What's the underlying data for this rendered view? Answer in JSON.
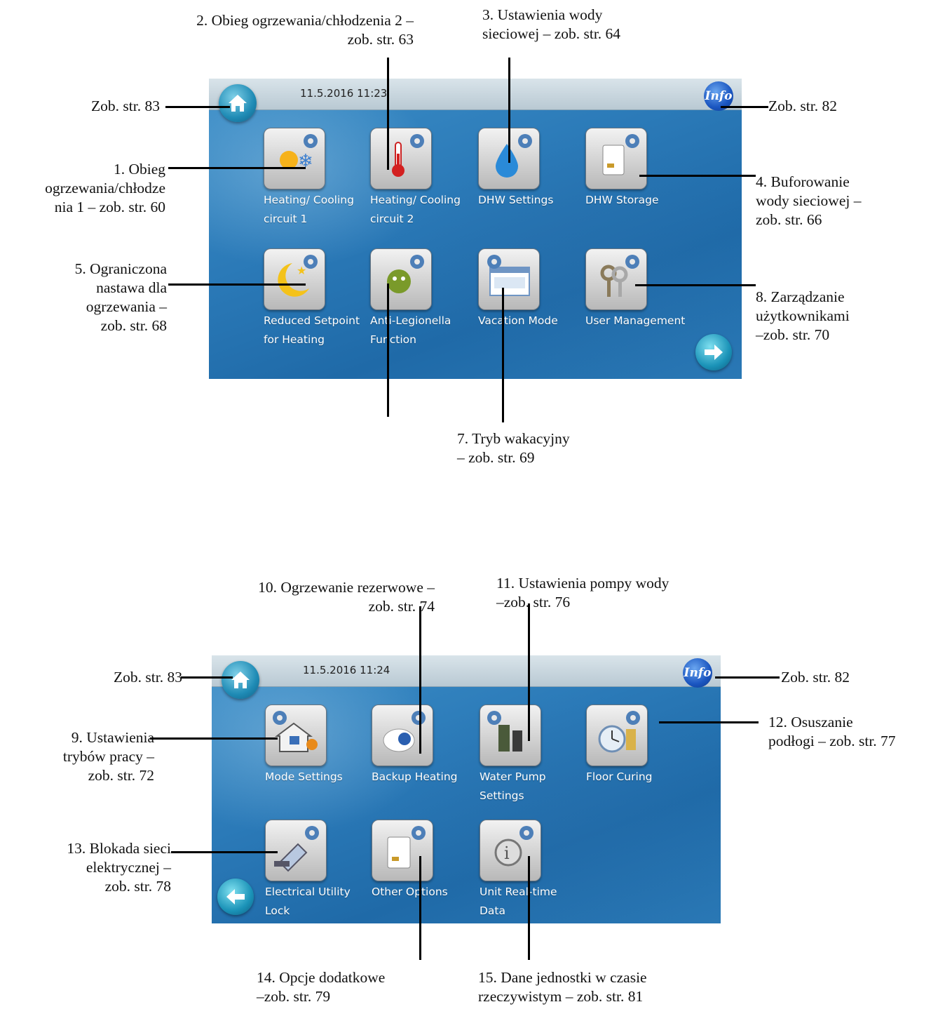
{
  "screens": [
    {
      "datetime": "11.5.2016 11:23",
      "info_label": "Info",
      "tiles": [
        {
          "label": "Heating/ Cooling circuit 1",
          "icon": "sun-snowflake-gear-icon"
        },
        {
          "label": "Heating/ Cooling circuit 2",
          "icon": "thermometer-gear-icon"
        },
        {
          "label": "DHW Settings",
          "icon": "water-drop-gear-icon"
        },
        {
          "label": "DHW Storage",
          "icon": "water-tank-gear-icon"
        },
        {
          "label": "Reduced Setpoint for Heating",
          "icon": "moon-star-gear-icon"
        },
        {
          "label": "Anti-Legionella Function",
          "icon": "germ-gear-icon"
        },
        {
          "label": "Vacation Mode",
          "icon": "calendar-gear-icon"
        },
        {
          "label": "User Management",
          "icon": "keys-gear-icon"
        }
      ],
      "nav": "next-arrow-icon"
    },
    {
      "datetime": "11.5.2016 11:24",
      "info_label": "Info",
      "tiles": [
        {
          "label": "Mode Settings",
          "icon": "house-flame-gear-icon"
        },
        {
          "label": "Backup Heating",
          "icon": "heater-gear-icon"
        },
        {
          "label": "Water Pump Settings",
          "icon": "pump-gear-icon"
        },
        {
          "label": "Floor Curing",
          "icon": "clock-gear-icon"
        },
        {
          "label": "Electrical Utility Lock",
          "icon": "plug-gear-icon"
        },
        {
          "label": "Other Options",
          "icon": "unit-gear-icon"
        },
        {
          "label": "Unit Real-time Data",
          "icon": "info-gear-icon"
        }
      ],
      "nav": "back-arrow-icon"
    }
  ],
  "annotations": {
    "s1_home": "Zob. str. 83",
    "s1_info": "Zob. str. 82",
    "s1_c1": "1. Obieg\nogrzewania/chłodze\nnia 1 – zob. str. 60",
    "s1_c2": "2. Obieg ogrzewania/chłodzenia 2 –\nzob. str. 63",
    "s1_dhw": "3. Ustawienia wody\nsieciowej – zob. str. 64",
    "s1_storage": "4. Buforowanie\nwody sieciowej –\nzob. str. 66",
    "s1_reduced": "5. Ograniczona\nnastawa dla\nogrzewania –\nzob. str. 68",
    "s1_vacation": "7. Tryb wakacyjny\n– zob. str. 69",
    "s1_user": "8. Zarządzanie\nużytkownikami\n–zob. str. 70",
    "s2_home": "Zob. str. 83",
    "s2_info": "Zob. str. 82",
    "s2_mode": "9. Ustawienia\ntrybów pracy –\nzob. str. 72",
    "s2_backup": "10. Ogrzewanie rezerwowe –\nzob. str. 74",
    "s2_pump": "11. Ustawienia pompy wody\n–zob. str. 76",
    "s2_floor": "12. Osuszanie\npodłogi – zob. str. 77",
    "s2_lock": "13. Blokada sieci\nelektrycznej –\nzob. str. 78",
    "s2_other": "14. Opcje dodatkowe\n–zob. str. 79",
    "s2_realtime": "15. Dane jednostki w czasie\nrzeczywistym – zob. str. 81"
  }
}
